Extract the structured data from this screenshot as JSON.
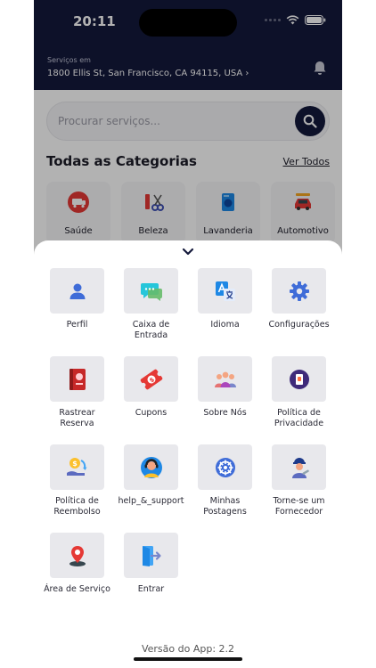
{
  "status_bar": {
    "time": "20:11"
  },
  "header": {
    "services_label": "Serviços em",
    "address": "1800 Ellis St, San Francisco, CA 94115, USA",
    "address_chevron": "›"
  },
  "search": {
    "placeholder": "Procurar serviços..."
  },
  "categories": {
    "title": "Todas as Categorias",
    "see_all": "Ver Todos",
    "items": [
      {
        "label": "Saúde",
        "icon": "ambulance-icon",
        "color": "#e53935"
      },
      {
        "label": "Beleza",
        "icon": "scissors-icon",
        "color": "#3f51b5"
      },
      {
        "label": "Lavanderia",
        "icon": "laundry-icon",
        "color": "#1e88e5"
      },
      {
        "label": "Automotivo",
        "icon": "car-icon",
        "color": "#e53935"
      }
    ]
  },
  "menu": {
    "items": [
      {
        "label": "Perfil",
        "icon": "user-icon"
      },
      {
        "label": "Caixa de\nEntrada",
        "icon": "chat-icon"
      },
      {
        "label": "Idioma",
        "icon": "translate-icon"
      },
      {
        "label": "Configurações",
        "icon": "gear-icon"
      },
      {
        "label": "Rastrear\nReserva",
        "icon": "booking-icon"
      },
      {
        "label": "Cupons",
        "icon": "coupon-icon"
      },
      {
        "label": "Sobre Nós",
        "icon": "people-icon"
      },
      {
        "label": "Política de\nPrivacidade",
        "icon": "privacy-icon"
      },
      {
        "label": "Política de\nReembolso",
        "icon": "refund-icon"
      },
      {
        "label": "help_&_support",
        "icon": "support-agent-icon"
      },
      {
        "label": "Minhas\nPostagens",
        "icon": "posts-icon"
      },
      {
        "label": "Torne-se um\nFornecedor",
        "icon": "provider-icon"
      },
      {
        "label": "Área de Serviço",
        "icon": "map-pin-icon"
      },
      {
        "label": "Entrar",
        "icon": "login-icon"
      }
    ]
  },
  "version": "Versão do App: 2.2",
  "colors": {
    "navy": "#14193b",
    "tile": "#e8e8ec",
    "accent": "#3f6cd8"
  }
}
